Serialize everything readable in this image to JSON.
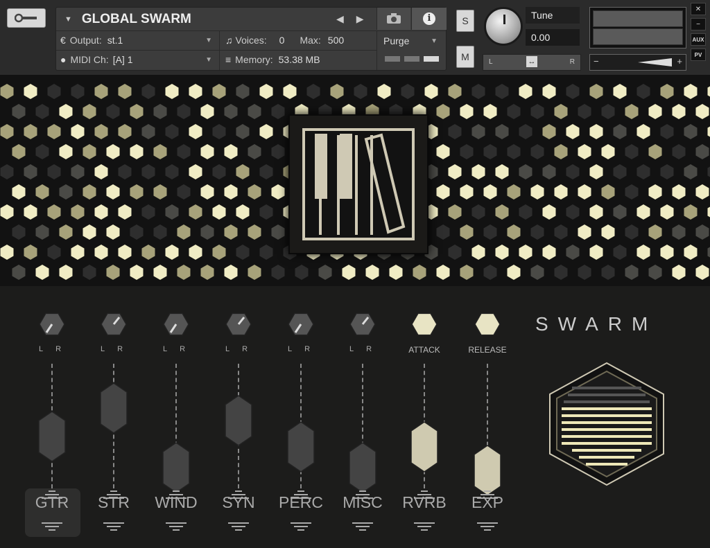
{
  "header": {
    "instrument_name": "GLOBAL SWARM",
    "output_label": "Output:",
    "output_value": "st.1",
    "voices_label": "Voices:",
    "voices_value": "0",
    "max_label": "Max:",
    "max_value": "500",
    "midi_label": "MIDI Ch:",
    "midi_value": "[A]  1",
    "memory_label": "Memory:",
    "memory_value": "53.38 MB",
    "purge_label": "Purge",
    "solo_label": "S",
    "mute_label": "M",
    "tune_label": "Tune",
    "tune_value": "0.00",
    "pan_left": "L",
    "pan_right": "R",
    "vol_minus": "−",
    "vol_plus": "+",
    "close": "✕",
    "minimize": "−",
    "aux": "AUX",
    "pv": "PV"
  },
  "brand": {
    "name": "SWARM"
  },
  "knobs": [
    {
      "name": "gtr-pan",
      "l": "L",
      "r": "R"
    },
    {
      "name": "str-pan",
      "l": "L",
      "r": "R"
    },
    {
      "name": "wind-pan",
      "l": "L",
      "r": "R"
    },
    {
      "name": "syn-pan",
      "l": "L",
      "r": "R"
    },
    {
      "name": "perc-pan",
      "l": "L",
      "r": "R"
    },
    {
      "name": "misc-pan",
      "l": "L",
      "r": "R"
    },
    {
      "name": "attack",
      "label": "ATTACK"
    },
    {
      "name": "release",
      "label": "RELEASE"
    }
  ],
  "channels": [
    {
      "label": "GTR",
      "level": 0.55
    },
    {
      "label": "STR",
      "level": 0.82
    },
    {
      "label": "WIND",
      "level": 0.25
    },
    {
      "label": "SYN",
      "level": 0.7
    },
    {
      "label": "PERC",
      "level": 0.45
    },
    {
      "label": "MISC",
      "level": 0.25
    },
    {
      "label": "RVRB",
      "level": 0.45
    },
    {
      "label": "EXP",
      "level": 0.22
    }
  ],
  "colors": {
    "glow": "#eee8b8",
    "dim": "#2e2e2e",
    "accent": "#cfc9b4"
  }
}
